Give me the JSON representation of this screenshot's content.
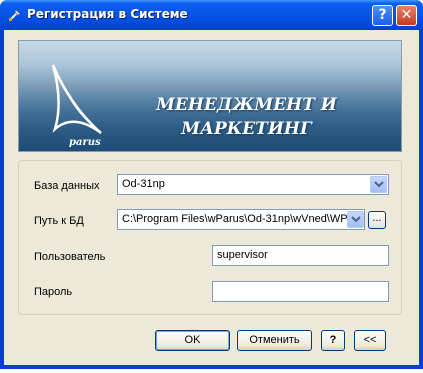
{
  "window": {
    "title": "Регистрация в Системе",
    "help_label": "?",
    "close_label": "✕"
  },
  "banner": {
    "line1": "МЕНЕДЖМЕНТ И",
    "line2": "МАРКЕТИНГ",
    "logo_text": "parus"
  },
  "form": {
    "database_label": "База данных",
    "database_value": "Od-31np",
    "path_label": "Путь к БД",
    "path_value": "C:\\Program Files\\wParus\\Od-31np\\wVned\\WP.",
    "browse_label": "...",
    "user_label": "Пользователь",
    "user_value": "supervisor",
    "password_label": "Пароль",
    "password_value": ""
  },
  "buttons": {
    "ok": "OK",
    "cancel": "Отменить",
    "help": "?",
    "collapse": "<<"
  },
  "colors": {
    "titlebar": "#0855e6",
    "client": "#ece9d8",
    "field_border": "#7f9db9"
  }
}
